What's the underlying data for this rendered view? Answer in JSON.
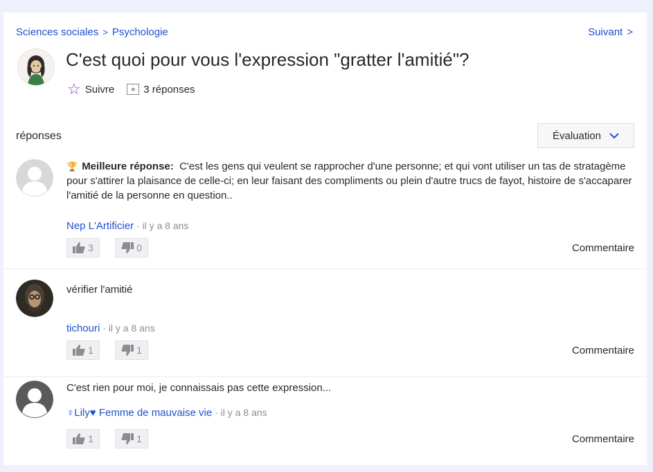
{
  "breadcrumb": {
    "category": "Sciences sociales",
    "separator": ">",
    "subcategory": "Psychologie"
  },
  "nav": {
    "next_label": "Suivant",
    "next_chevron": ">"
  },
  "question": {
    "title": "C'est quoi pour vous l'expression \"gratter l'amitié\"?",
    "follow_label": "Suivre",
    "answers_count_label": "3 réponses"
  },
  "responses": {
    "label": "réponses",
    "sort_label": "Évaluation"
  },
  "answers": [
    {
      "best_label": "Meilleure réponse:",
      "text": "C'est les gens qui veulent se rapprocher d'une personne; et qui vont utiliser un tas de stratagème pour s'attirer la plaisance de celle-ci; en leur faisant des compliments ou plein d'autre trucs de fayot, histoire de s'accaparer l'amitié de la personne en question..",
      "author": "Nep L'Artificier",
      "time": "· il y a 8 ans",
      "upvotes": "3",
      "downvotes": "0",
      "comment_label": "Commentaire"
    },
    {
      "text": "vérifier l'amitié",
      "author": "tichouri",
      "time": "· il y a 8 ans",
      "upvotes": "1",
      "downvotes": "1",
      "comment_label": "Commentaire"
    },
    {
      "text": "C'est rien pour moi, je connaissais pas cette expression...",
      "author": "♀Lily♥ Femme de mauvaise vie",
      "time": "· il y a 8 ans",
      "upvotes": "1",
      "downvotes": "1",
      "comment_label": "Commentaire"
    }
  ],
  "colors": {
    "link": "#1f50d1",
    "accent_star": "#7b3bd6",
    "trophy": "#e9a900",
    "page_bg": "#eef0fb"
  },
  "icons": [
    "star-outline-icon",
    "answers-icon",
    "chevron-down-icon",
    "trophy-icon",
    "thumbs-up-icon",
    "thumbs-down-icon"
  ]
}
